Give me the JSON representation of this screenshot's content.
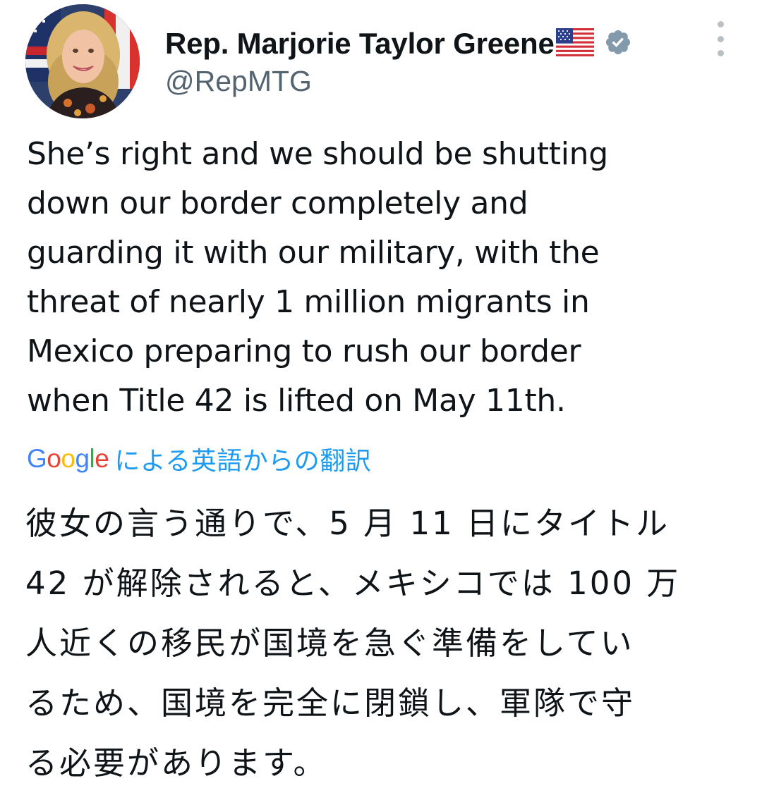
{
  "author": {
    "display_name": "Rep. Marjorie Taylor Greene",
    "handle": "@RepMTG",
    "avatar_icon": "profile-photo",
    "badge_icon": "verified-badge-icon",
    "flag_icon": "us-flag-emoji-icon",
    "badge_color": "#829aab"
  },
  "tweet": {
    "text_lines": [
      "She’s right and we should be shutting",
      "down our border completely and",
      "guarding it with our military, with the",
      "threat of nearly 1 million migrants in",
      "Mexico preparing to rush our border",
      "when Title 42 is lifted on May 11th."
    ]
  },
  "translation": {
    "provider": "Google",
    "label": "による英語からの翻訳",
    "link_color": "#1d9bf0",
    "text_lines": [
      "彼女の言う通りで、5 月 11 日にタイトル",
      "42 が解除されると、メキシコでは 100 万",
      "人近くの移民が国境を急ぐ準備をしてい",
      "るため、国境を完全に閉鎖し、軍隊で守",
      "る必要があります。"
    ]
  },
  "more_menu_icon": "more-vertical-icon"
}
